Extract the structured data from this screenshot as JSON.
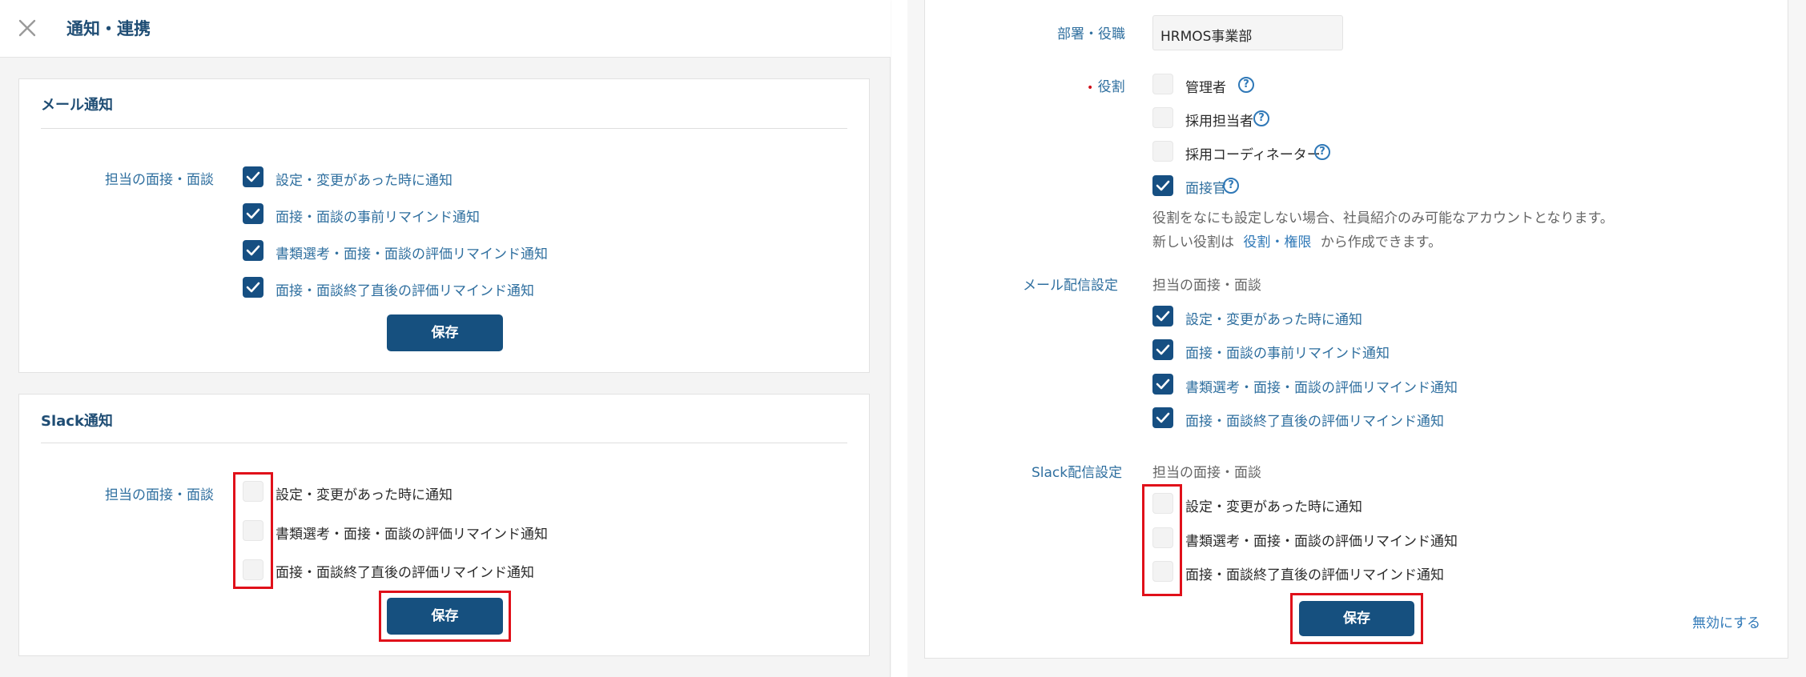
{
  "left": {
    "header": {
      "title": "通知・連携",
      "close_icon": "close-icon"
    },
    "mail": {
      "title": "メール通知",
      "row_label": "担当の面接・面談",
      "items": [
        {
          "label": "設定・変更があった時に通知",
          "checked": true
        },
        {
          "label": "面接・面談の事前リマインド通知",
          "checked": true
        },
        {
          "label": "書類選考・面接・面談の評価リマインド通知",
          "checked": true
        },
        {
          "label": "面接・面談終了直後の評価リマインド通知",
          "checked": true
        }
      ],
      "save_label": "保存"
    },
    "slack": {
      "title": "Slack通知",
      "row_label": "担当の面接・面談",
      "items": [
        {
          "label": "設定・変更があった時に通知",
          "checked": false
        },
        {
          "label": "書類選考・面接・面談の評価リマインド通知",
          "checked": false
        },
        {
          "label": "面接・面談終了直後の評価リマインド通知",
          "checked": false
        }
      ],
      "save_label": "保存"
    }
  },
  "right": {
    "department": {
      "label": "部署・役職",
      "value": "HRMOS事業部"
    },
    "role": {
      "required_mark": "•",
      "label": "役割",
      "items": [
        {
          "label": "管理者",
          "checked": false,
          "help": "?"
        },
        {
          "label": "採用担当者",
          "checked": false,
          "help": "?"
        },
        {
          "label": "採用コーディネーター",
          "checked": false,
          "help": "?"
        },
        {
          "label": "面接官",
          "checked": true,
          "help": "?"
        }
      ],
      "note1": "役割をなにも設定しない場合、社員紹介のみ可能なアカウントとなります。",
      "note2_prefix": "新しい役割は",
      "note2_link": "役割・権限",
      "note2_suffix": "から作成できます。"
    },
    "mail_delivery": {
      "label": "メール配信設定",
      "sub": "担当の面接・面談",
      "items": [
        {
          "label": "設定・変更があった時に通知",
          "checked": true
        },
        {
          "label": "面接・面談の事前リマインド通知",
          "checked": true
        },
        {
          "label": "書類選考・面接・面談の評価リマインド通知",
          "checked": true
        },
        {
          "label": "面接・面談終了直後の評価リマインド通知",
          "checked": true
        }
      ]
    },
    "slack_delivery": {
      "label": "Slack配信設定",
      "sub": "担当の面接・面談",
      "items": [
        {
          "label": "設定・変更があった時に通知",
          "checked": false
        },
        {
          "label": "書類選考・面接・面談の評価リマインド通知",
          "checked": false
        },
        {
          "label": "面接・面談終了直後の評価リマインド通知",
          "checked": false
        }
      ]
    },
    "save_label": "保存",
    "disable_label": "無効にする"
  },
  "colors": {
    "primary": "#16507f",
    "label_blue": "#2f6f9f",
    "highlight": "#e0101a",
    "required": "#d0101a"
  }
}
